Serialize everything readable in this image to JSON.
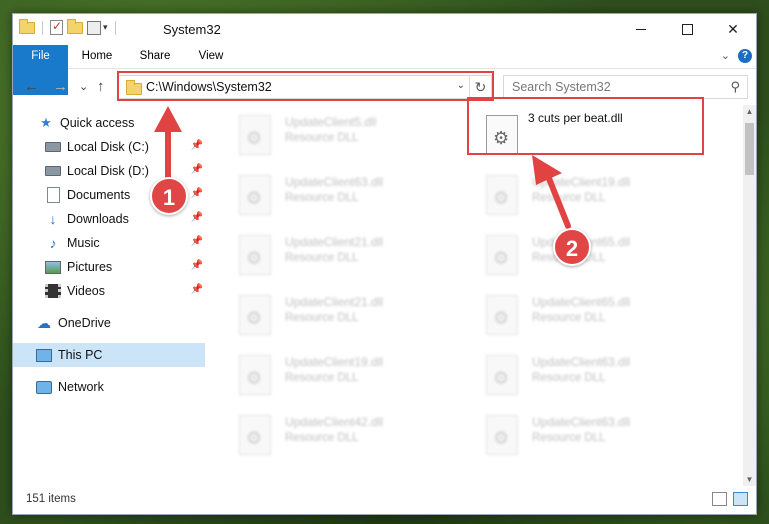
{
  "window": {
    "title": "System32",
    "min_label": "",
    "max_label": "",
    "close_label": "✕"
  },
  "ribbon": {
    "tabs": [
      "File",
      "Home",
      "Share",
      "View"
    ],
    "expand_label": "⌄",
    "help_label": "?"
  },
  "navbar": {
    "back": "←",
    "forward": "→",
    "recent": "⌄",
    "up": "↑",
    "address": "C:\\Windows\\System32",
    "refresh": "↻",
    "search_placeholder": "Search System32"
  },
  "sidebar": {
    "items": [
      {
        "label": "Quick access",
        "icon": "star-icon",
        "pinned": false
      },
      {
        "label": "Local Disk (C:)",
        "icon": "disk-icon",
        "pinned": true
      },
      {
        "label": "Local Disk (D:)",
        "icon": "disk-icon",
        "pinned": true
      },
      {
        "label": "Documents",
        "icon": "documents-icon",
        "pinned": true
      },
      {
        "label": "Downloads",
        "icon": "downloads-icon",
        "pinned": true
      },
      {
        "label": "Music",
        "icon": "music-icon",
        "pinned": true
      },
      {
        "label": "Pictures",
        "icon": "pictures-icon",
        "pinned": true
      },
      {
        "label": "Videos",
        "icon": "videos-icon",
        "pinned": true
      },
      {
        "label": "OneDrive",
        "icon": "onedrive-icon",
        "pinned": false
      },
      {
        "label": "This PC",
        "icon": "pc-icon",
        "pinned": false,
        "selected": true
      },
      {
        "label": "Network",
        "icon": "network-icon",
        "pinned": false
      }
    ]
  },
  "files": [
    {
      "name": "UpdateClient5.dll",
      "type": "Resource DLL"
    },
    {
      "name": "3 cuts per beat.dll",
      "type": ""
    },
    {
      "name": "UpdateClient63.dll",
      "type": "Resource DLL"
    },
    {
      "name": "UpdateClient19.dll",
      "type": "Resource DLL"
    },
    {
      "name": "UpdateClient21.dll",
      "type": "Resource DLL"
    },
    {
      "name": "UpdateClient65.dll",
      "type": "Resource DLL"
    },
    {
      "name": "UpdateClient21.dll",
      "type": "Resource DLL"
    },
    {
      "name": "UpdateClient65.dll",
      "type": "Resource DLL"
    },
    {
      "name": "UpdateClient19.dll",
      "type": "Resource DLL"
    },
    {
      "name": "UpdateClient63.dll",
      "type": "Resource DLL"
    },
    {
      "name": "UpdateClient42.dll",
      "type": "Resource DLL"
    },
    {
      "name": "UpdateClient63.dll",
      "type": "Resource DLL"
    }
  ],
  "status": {
    "item_count": "151 items"
  },
  "annotations": {
    "badge1": "1",
    "badge2": "2",
    "color": "#e14343"
  },
  "colors": {
    "accent": "#1979ca",
    "selected_bg": "#cce4f7"
  }
}
